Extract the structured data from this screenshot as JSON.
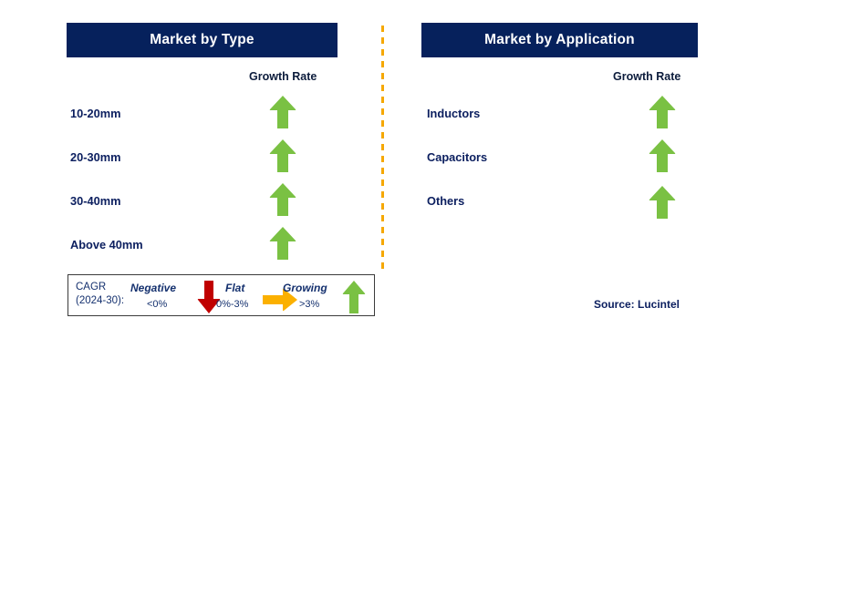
{
  "panels": {
    "type": {
      "header": "Market by Type",
      "growth_rate_label": "Growth Rate",
      "rows": [
        {
          "label": "10-20mm",
          "trend": "growing",
          "icon": "arrow-up-icon"
        },
        {
          "label": "20-30mm",
          "trend": "growing",
          "icon": "arrow-up-icon"
        },
        {
          "label": "30-40mm",
          "trend": "growing",
          "icon": "arrow-up-icon"
        },
        {
          "label": "Above 40mm",
          "trend": "growing",
          "icon": "arrow-up-icon"
        }
      ]
    },
    "application": {
      "header": "Market by Application",
      "growth_rate_label": "Growth Rate",
      "rows": [
        {
          "label": "Inductors",
          "trend": "growing",
          "icon": "arrow-up-icon"
        },
        {
          "label": "Capacitors",
          "trend": "growing",
          "icon": "arrow-up-icon"
        },
        {
          "label": "Others",
          "trend": "growing",
          "icon": "arrow-up-icon"
        }
      ]
    }
  },
  "legend": {
    "title_line1": "CAGR",
    "title_line2": "(2024-30):",
    "entries": [
      {
        "term": "Negative",
        "range": "<0%",
        "icon": "arrow-down-icon",
        "color": "#c00000"
      },
      {
        "term": "Flat",
        "range": "0%-3%",
        "icon": "arrow-right-icon",
        "color": "#fbb000"
      },
      {
        "term": "Growing",
        "range": ">3%",
        "icon": "arrow-up-icon",
        "color": "#7ac143"
      }
    ]
  },
  "source": "Source: Lucintel",
  "colors": {
    "header_bg": "#06215c",
    "header_text": "#ffffff",
    "label_text": "#0d2060",
    "growing": "#7ac143",
    "negative": "#c00000",
    "flat": "#fbb000",
    "divider": "#f5a800",
    "legend_border": "#3b3b3b"
  }
}
